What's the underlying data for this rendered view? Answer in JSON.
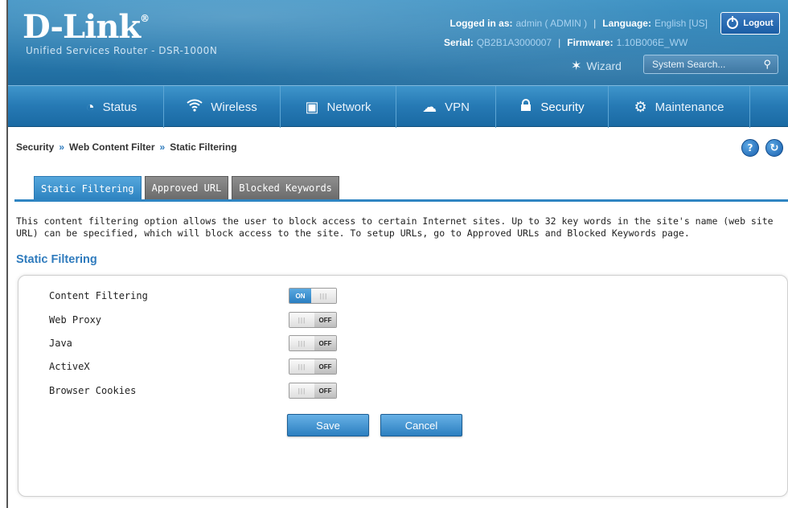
{
  "header": {
    "logo": "D-Link",
    "logo_mark": "®",
    "subtitle": "Unified Services Router - DSR-1000N",
    "logged_in_label": "Logged in as:",
    "logged_in_value": "admin ( ADMIN )",
    "language_label": "Language:",
    "language_value": "English [US]",
    "serial_label": "Serial:",
    "serial_value": "QB2B1A3000007",
    "firmware_label": "Firmware:",
    "firmware_value": "1.10B006E_WW",
    "logout_label": "Logout",
    "wizard_label": "Wizard",
    "search_placeholder": "System Search..."
  },
  "nav": {
    "items": [
      {
        "label": "Status",
        "icon": "gauge-icon"
      },
      {
        "label": "Wireless",
        "icon": "wifi-icon"
      },
      {
        "label": "Network",
        "icon": "monitor-icon"
      },
      {
        "label": "VPN",
        "icon": "cloud-lock-icon"
      },
      {
        "label": "Security",
        "icon": "lock-icon"
      },
      {
        "label": "Maintenance",
        "icon": "gears-icon"
      }
    ],
    "active": "Security"
  },
  "breadcrumb": {
    "items": [
      "Security",
      "Web Content Filter",
      "Static Filtering"
    ],
    "separator": "»"
  },
  "tabs": [
    {
      "label": "Static Filtering",
      "active": true
    },
    {
      "label": "Approved URL",
      "active": false
    },
    {
      "label": "Blocked Keywords",
      "active": false
    }
  ],
  "description": "This content filtering option allows the user to block access to certain Internet sites. Up to 32 key words in the site's name (web site URL) can be specified, which will block access to the site. To setup URLs, go to Approved URLs and Blocked Keywords page.",
  "section_title": "Static Filtering",
  "settings": [
    {
      "label": "Content Filtering",
      "state": "ON"
    },
    {
      "label": "Web Proxy",
      "state": "OFF"
    },
    {
      "label": "Java",
      "state": "OFF"
    },
    {
      "label": "ActiveX",
      "state": "OFF"
    },
    {
      "label": "Browser Cookies",
      "state": "OFF"
    }
  ],
  "buttons": {
    "save": "Save",
    "cancel": "Cancel"
  },
  "colors": {
    "accent": "#2f7bbd",
    "header": "#2b7db1"
  }
}
